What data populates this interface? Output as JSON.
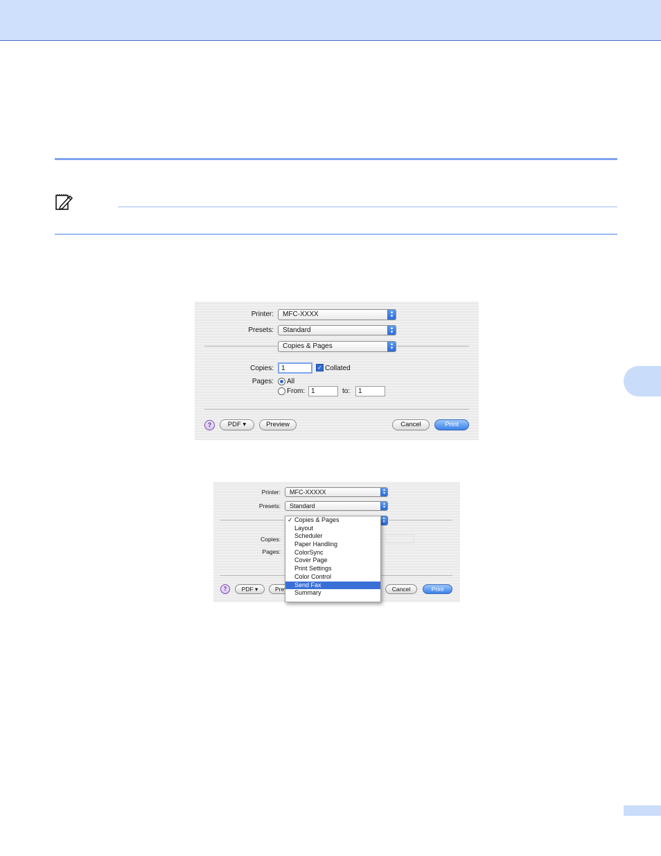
{
  "dialog1": {
    "printer_label": "Printer:",
    "printer_value": "MFC-XXXX",
    "presets_label": "Presets:",
    "presets_value": "Standard",
    "pane_value": "Copies & Pages",
    "copies_label": "Copies:",
    "copies_value": "1",
    "collated_label": "Collated",
    "pages_label": "Pages:",
    "all_label": "All",
    "from_label": "From:",
    "from_value": "1",
    "to_label": "to:",
    "to_value": "1",
    "help_label": "?",
    "pdf_label": "PDF ▾",
    "preview_label": "Preview",
    "cancel_label": "Cancel",
    "print_label": "Print"
  },
  "dialog2": {
    "printer_label": "Printer:",
    "printer_value": "MFC-XXXXX",
    "presets_label": "Presets:",
    "presets_value": "Standard",
    "copies_label": "Copies:",
    "pages_label": "Pages:",
    "help_label": "?",
    "pdf_label": "PDF ▾",
    "preview_label": "Previ",
    "cancel_label": "Cancel",
    "print_label": "Print",
    "checkmark": "✓",
    "menu_items": [
      "Copies & Pages",
      "Layout",
      "Scheduler",
      "Paper Handling",
      "ColorSync",
      "Cover Page",
      "Print Settings",
      "Color Control",
      "Send Fax",
      "Summary"
    ]
  },
  "colors": {
    "header_band": "#cfe0fd",
    "accent_rule": "#7fa2ee",
    "menu_highlight": "#3a6fd8"
  }
}
